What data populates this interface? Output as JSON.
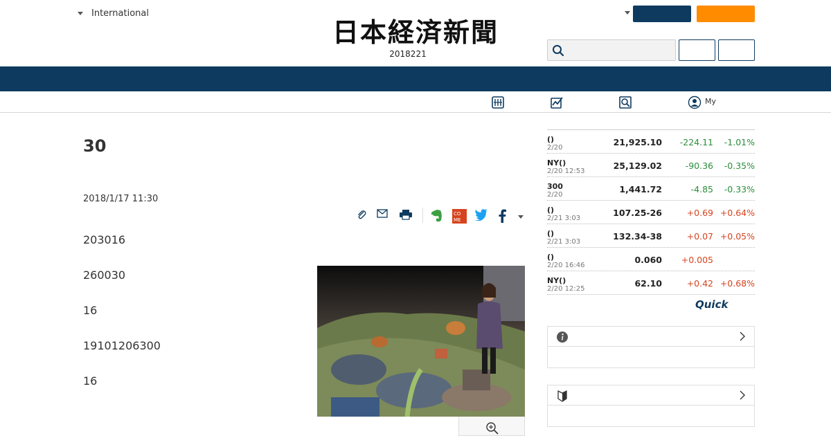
{
  "header": {
    "edition": "International",
    "masthead": "日本経済新聞",
    "date": "2018221"
  },
  "article": {
    "headline": "30",
    "date": "2018/1/17 11:30",
    "paragraphs": [
      "203016",
      "260030",
      "16",
      "19101206300",
      "16"
    ]
  },
  "subnav": {
    "my_label": "My"
  },
  "market": {
    "rows": [
      {
        "name": "()",
        "time": "2/20",
        "value": "21,925.10",
        "change": "-224.11",
        "pct": "-1.01%",
        "dir": "down"
      },
      {
        "name": "NY()",
        "time": "2/20 12:53",
        "value": "25,129.02",
        "change": "-90.36",
        "pct": "-0.35%",
        "dir": "down"
      },
      {
        "name": "300",
        "time": "2/20",
        "value": "1,441.72",
        "change": "-4.85",
        "pct": "-0.33%",
        "dir": "down"
      },
      {
        "name": "()",
        "time": "2/21 3:03",
        "value": "107.25-26",
        "change": "+0.69",
        "pct": "+0.64%",
        "dir": "up"
      },
      {
        "name": "()",
        "time": "2/21 3:03",
        "value": "132.34-38",
        "change": "+0.07",
        "pct": "+0.05%",
        "dir": "up"
      },
      {
        "name": "()",
        "time": "2/20 16:46",
        "value": "0.060",
        "change": "+0.005",
        "pct": "",
        "dir": "up"
      },
      {
        "name": "NY()",
        "time": "2/20 12:25",
        "value": "62.10",
        "change": "+0.42",
        "pct": "+0.68%",
        "dir": "up"
      }
    ],
    "brand": "Quick"
  },
  "colors": {
    "navy": "#0e3a5f",
    "orange": "#ff8b00",
    "down": "#2a8d3a",
    "up": "#d6431e"
  }
}
